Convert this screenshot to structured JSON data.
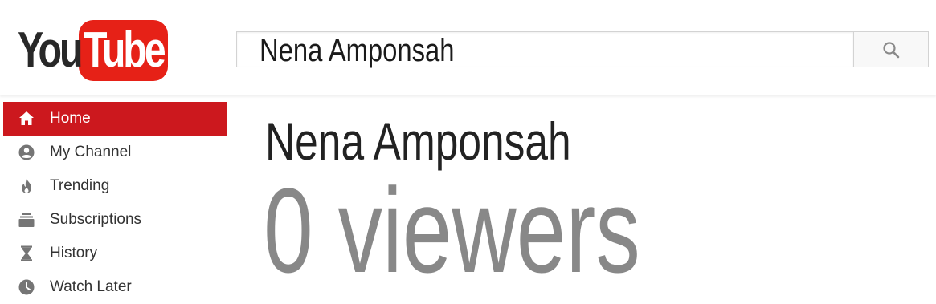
{
  "header": {
    "logo": {
      "part1": "You",
      "part2": "Tube"
    },
    "search": {
      "value": "Nena Amponsah"
    }
  },
  "sidebar": {
    "items": [
      {
        "label": "Home",
        "icon": "home-icon",
        "active": true
      },
      {
        "label": "My Channel",
        "icon": "account-icon",
        "active": false
      },
      {
        "label": "Trending",
        "icon": "flame-icon",
        "active": false
      },
      {
        "label": "Subscriptions",
        "icon": "subscriptions-icon",
        "active": false
      },
      {
        "label": "History",
        "icon": "hourglass-icon",
        "active": false
      },
      {
        "label": "Watch Later",
        "icon": "clock-icon",
        "active": false
      }
    ]
  },
  "main": {
    "channel_name": "Nena Amponsah",
    "viewers_text": "0 viewers"
  },
  "colors": {
    "brand_red": "#e62117",
    "active_nav": "#cc181e",
    "viewers_gray": "#888888"
  }
}
